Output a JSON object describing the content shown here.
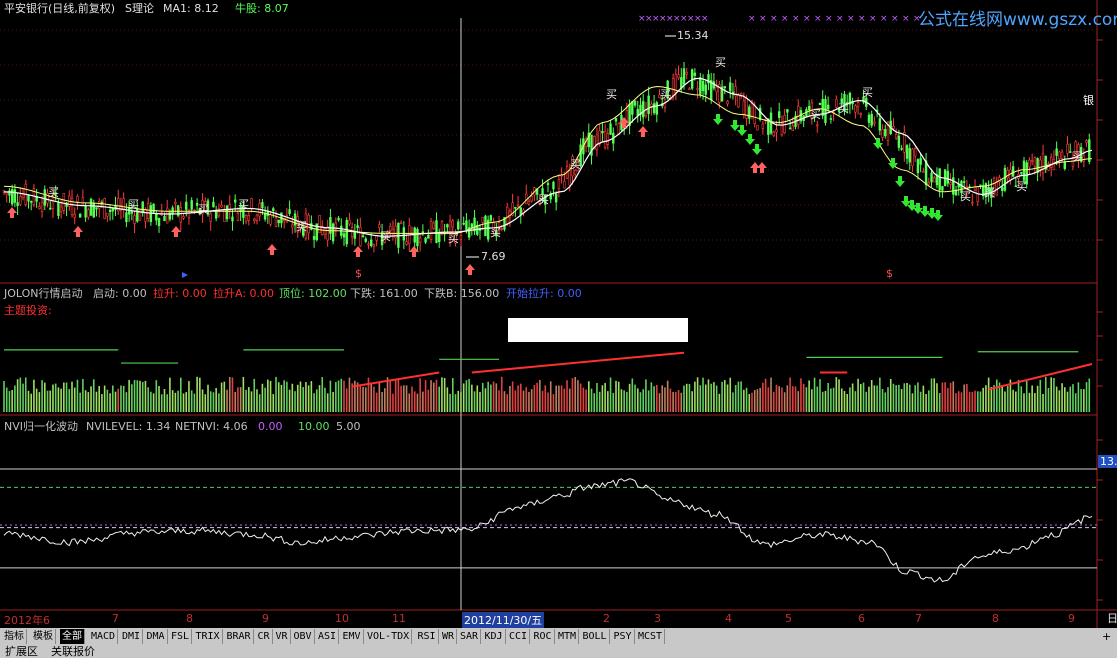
{
  "panel1": {
    "title": "平安银行(日线,前复权)",
    "theory": "S理论",
    "ma_label": "MA1: 8.12",
    "bull_label": "牛股: 8.07",
    "high_label": "15.34",
    "low_label": "7.69",
    "watermark": "公式在线网www.gszx.com.cn",
    "buy_tag": "买",
    "right_tag": "银",
    "dollar_tag": "$",
    "colors": {
      "up": "#ff3c3c",
      "down": "#54ff54",
      "ma": "#ffffff",
      "bull": "#ffff80",
      "arrow_up": "#ff6060",
      "arrow_down": "#30e830",
      "x_mark": "#c060ff"
    }
  },
  "panel2": {
    "name": "JOLON行情启动",
    "items": [
      {
        "label": "启动: 0.00",
        "color": "#c0c0c0"
      },
      {
        "label": "拉升: 0.00",
        "color": "#ff3030"
      },
      {
        "label": "拉升A: 0.00",
        "color": "#ff3030"
      },
      {
        "label": "顶位: 102.00",
        "color": "#60e060"
      },
      {
        "label": "下跌: 161.00",
        "color": "#c0c0c0"
      },
      {
        "label": "下跌B: 156.00",
        "color": "#c0c0c0"
      },
      {
        "label": "开始拉升: 0.00",
        "color": "#4060ff"
      }
    ],
    "sub_label": "主题投资:"
  },
  "panel3": {
    "name": "NVI归一化波动",
    "items": [
      {
        "label": "NVILEVEL: 1.34",
        "color": "#c0c0c0"
      },
      {
        "label": "NETNVI: 4.06",
        "color": "#c0c0c0"
      },
      {
        "label": "0.00",
        "color": "#c060ff"
      },
      {
        "label": "10.00",
        "color": "#60e060"
      },
      {
        "label": "5.00",
        "color": "#c0c0c0"
      }
    ],
    "right_value": "13.4"
  },
  "x_axis": {
    "labels": [
      "2012年6",
      "7",
      "8",
      "9",
      "10",
      "11",
      "2012/11/30/五",
      "2",
      "3",
      "4",
      "5",
      "6",
      "7",
      "8",
      "9"
    ],
    "right_label": "日"
  },
  "tabs": {
    "items": [
      "指标",
      "模板",
      "全部",
      "MACD",
      "DMI",
      "DMA",
      "FSL",
      "TRIX",
      "BRAR",
      "CR",
      "VR",
      "OBV",
      "ASI",
      "EMV",
      "VOL-TDX",
      "RSI",
      "WR",
      "SAR",
      "KDJ",
      "CCI",
      "ROC",
      "MTM",
      "BOLL",
      "PSY",
      "MCST"
    ],
    "active": "全部",
    "plus": "+"
  },
  "bottom_tabs": [
    "扩展区",
    "关联报价"
  ],
  "chart_data": [
    {
      "type": "line",
      "title": "平安银行(日线,前复权)",
      "series": [
        {
          "name": "MA1",
          "anchors": [
            [
              0,
              9.8
            ],
            [
              30,
              9.3
            ],
            [
              60,
              9.0
            ],
            [
              90,
              9.2
            ],
            [
              120,
              8.5
            ],
            [
              140,
              8.2
            ],
            [
              165,
              8.35
            ],
            [
              180,
              8.5
            ],
            [
              205,
              9.8
            ],
            [
              220,
              11.6
            ],
            [
              240,
              12.9
            ],
            [
              255,
              13.9
            ],
            [
              270,
              13.3
            ],
            [
              285,
              12.2
            ],
            [
              300,
              12.6
            ],
            [
              315,
              13.1
            ],
            [
              330,
              11.9
            ],
            [
              345,
              10.3
            ],
            [
              360,
              9.7
            ],
            [
              375,
              10.4
            ],
            [
              392,
              11.0
            ],
            [
              400,
              11.3
            ]
          ]
        },
        {
          "name": "牛股",
          "anchors": [
            [
              0,
              10.0
            ],
            [
              30,
              9.4
            ],
            [
              60,
              9.1
            ],
            [
              90,
              9.1
            ],
            [
              120,
              8.4
            ],
            [
              140,
              8.3
            ],
            [
              165,
              8.3
            ],
            [
              180,
              8.7
            ],
            [
              205,
              10.4
            ],
            [
              220,
              12.3
            ],
            [
              240,
              13.6
            ],
            [
              255,
              13.3
            ],
            [
              270,
              12.6
            ],
            [
              285,
              12.3
            ],
            [
              300,
              12.8
            ],
            [
              315,
              12.2
            ],
            [
              330,
              10.6
            ],
            [
              345,
              9.8
            ],
            [
              360,
              10.0
            ],
            [
              375,
              10.6
            ],
            [
              392,
              10.9
            ],
            [
              400,
              11.0
            ]
          ]
        }
      ],
      "high": 15.34,
      "low": 7.69,
      "ylim": [
        6.8,
        16.0
      ]
    },
    {
      "type": "bar",
      "title": "JOLON行情启动",
      "series": [
        {
          "name": "顶位",
          "value": 102.0
        },
        {
          "name": "下跌",
          "value": 161.0
        },
        {
          "name": "下跌B",
          "value": 156.0
        }
      ],
      "ylim": [
        0,
        170
      ]
    },
    {
      "type": "line",
      "title": "NVI归一化波动",
      "series": [
        {
          "name": "NETNVI",
          "anchors": [
            [
              0,
              4.3
            ],
            [
              25,
              3.2
            ],
            [
              50,
              4.4
            ],
            [
              70,
              4.6
            ],
            [
              90,
              4.2
            ],
            [
              110,
              3.1
            ],
            [
              128,
              3.9
            ],
            [
              150,
              4.6
            ],
            [
              170,
              4.7
            ],
            [
              190,
              7.6
            ],
            [
              205,
              9.0
            ],
            [
              215,
              10.1
            ],
            [
              230,
              10.7
            ],
            [
              245,
              8.3
            ],
            [
              262,
              6.7
            ],
            [
              280,
              2.9
            ],
            [
              300,
              4.1
            ],
            [
              318,
              3.3
            ],
            [
              332,
              -0.5
            ],
            [
              345,
              -1.6
            ],
            [
              358,
              1.4
            ],
            [
              372,
              2.3
            ],
            [
              385,
              4.1
            ],
            [
              400,
              6.3
            ]
          ]
        }
      ],
      "reference_lines": [
        {
          "name": "0",
          "value": 0.0
        },
        {
          "name": "5",
          "value": 5.0
        },
        {
          "name": "10",
          "value": 10.0
        }
      ],
      "ylim": [
        -4,
        13.4
      ]
    }
  ]
}
